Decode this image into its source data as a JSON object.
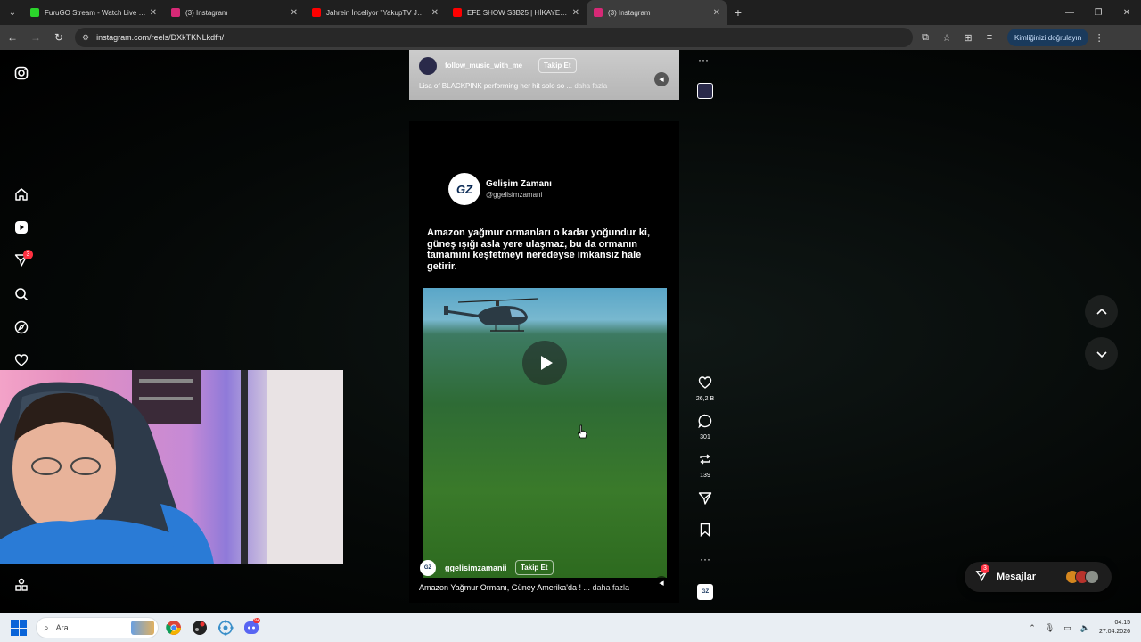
{
  "browser": {
    "tabs": [
      {
        "title": "FuruGO Stream - Watch Live o...",
        "favicon_color": "#2bd42b",
        "active": false
      },
      {
        "title": "(3) Instagram",
        "favicon_color": "#d62976",
        "active": false
      },
      {
        "title": "Jahrein İnceliyor \"YakupTV Jeto...",
        "favicon_color": "#ff0000",
        "active": false
      },
      {
        "title": "EFE SHOW S3B25 | HİKAYEDEN...",
        "favicon_color": "#ff0000",
        "active": false
      },
      {
        "title": "(3) Instagram",
        "favicon_color": "#d62976",
        "active": true
      }
    ],
    "new_tab": "+",
    "url": "instagram.com/reels/DXkTKNLkdfn/",
    "verify_label": "Kimliğinizi doğrulayın"
  },
  "sidebar": {
    "notification_count": "3"
  },
  "previous_reel": {
    "username": "follow_music_with_me",
    "follow_label": "Takip Et",
    "caption": "Lisa of BLACKPINK performing her hit solo so ...",
    "more_label": "daha fazla",
    "more_actions": "···"
  },
  "reel": {
    "brand_name": "Gelişim Zamanı",
    "brand_handle": "@ggelisimzamani",
    "brand_logo_text": "GZ",
    "headline": "Amazon yağmur ormanları o kadar yoğundur ki, güneş ışığı asla yere ulaşmaz, bu da ormanın tamamını keşfetmeyi neredeyse imkansız hale getirir.",
    "username": "ggelisimzamanii",
    "follow_label": "Takip Et",
    "caption": "Amazon Yağmur Ormanı, Güney Amerika'da ! ...",
    "more_label": "daha fazla"
  },
  "actions": {
    "likes": "26,2 B",
    "comments": "301",
    "reposts": "139",
    "more": "···"
  },
  "messages": {
    "label": "Mesajlar",
    "badge": "3"
  },
  "taskbar": {
    "search_placeholder": "Ara",
    "time": "04:15",
    "date": "27.04.2026",
    "discord_badge": "9+"
  },
  "colors": {
    "accent_blue": "#0a64d8",
    "badge_red": "#ff3040",
    "browser_dark": "#1f1f1f"
  }
}
